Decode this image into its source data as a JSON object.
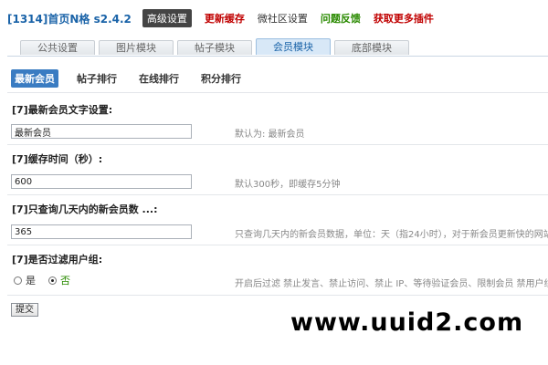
{
  "header": {
    "plugin_title": "[1314]首页N格 s2.4.2",
    "links": [
      {
        "label": "高级设置"
      },
      {
        "label": "更新缓存"
      },
      {
        "label": "微社区设置"
      },
      {
        "label": "问题反馈"
      },
      {
        "label": "获取更多插件"
      }
    ]
  },
  "tabs": [
    {
      "label": "公共设置"
    },
    {
      "label": "图片模块"
    },
    {
      "label": "帖子模块"
    },
    {
      "label": "会员模块"
    },
    {
      "label": "底部模块"
    }
  ],
  "subtabs": [
    {
      "label": "最新会员"
    },
    {
      "label": "帖子排行"
    },
    {
      "label": "在线排行"
    },
    {
      "label": "积分排行"
    }
  ],
  "settings": [
    {
      "label": "[7]最新会员文字设置:",
      "value": "最新会员",
      "hint": "默认为: 最新会员"
    },
    {
      "label": "[7]缓存时间（秒）:",
      "value": "600",
      "hint": "默认300秒，即缓存5分钟"
    },
    {
      "label": "[7]只查询几天内的新会员数 ...:",
      "value": "365",
      "hint": "只查询几天内的新会员数据，单位：天（指24小时），对于新会员更新快的网站一般"
    },
    {
      "label": "[7]是否过滤用户组:",
      "options": [
        "是",
        "否"
      ],
      "selected": "否",
      "hint": "开启后过滤 禁止发言、禁止访问、禁止 IP、等待验证会员、限制会员 禁用户组，无"
    }
  ],
  "submit_label": "提交",
  "watermark": "www.uuid2.com"
}
